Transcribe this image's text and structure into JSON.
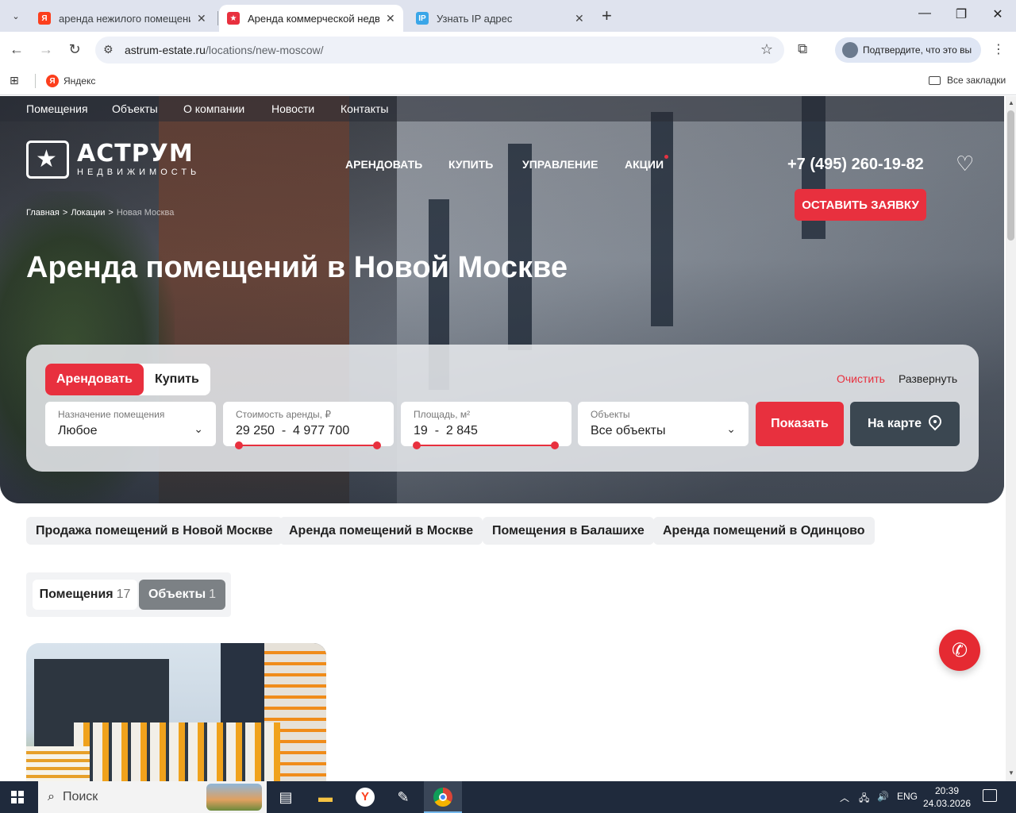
{
  "browser": {
    "tabs": [
      {
        "title": "аренда нежилого помещения",
        "favicon": "yandex-icon",
        "active": false
      },
      {
        "title": "Аренда коммерческой недвиж",
        "favicon": "astrum-icon",
        "active": true
      },
      {
        "title": "Узнать IP адрес",
        "favicon": "ip-icon",
        "active": false
      }
    ],
    "url_host": "astrum-estate.ru",
    "url_path": "/locations/new-moscow/",
    "verify_label": "Подтвердите, что это вы",
    "bookmarks": {
      "yandex": "Яндекс",
      "all": "Все закладки"
    }
  },
  "site": {
    "topnav": [
      "Помещения",
      "Объекты",
      "О компании",
      "Новости",
      "Контакты"
    ],
    "logo": {
      "main": "АСТРУМ",
      "sub": "НЕДВИЖИМОСТЬ"
    },
    "mainnav": [
      "АРЕНДОВАТЬ",
      "КУПИТЬ",
      "УПРАВЛЕНИЕ",
      "АКЦИИ"
    ],
    "phone": "+7 (495) 260-19-82",
    "cta": "ОСТАВИТЬ ЗАЯВКУ",
    "breadcrumbs": {
      "home": "Главная",
      "locations": "Локации",
      "current": "Новая Москва",
      "sep": ">"
    },
    "title": "Аренда помещений в Новой Москве",
    "filter": {
      "rent": "Арендовать",
      "buy": "Купить",
      "clear": "Очистить",
      "expand": "Развернуть",
      "purpose": {
        "label": "Назначение помещения",
        "value": "Любое"
      },
      "price": {
        "label": "Стоимость аренды, ₽",
        "min": "29 250",
        "max": "4 977 700"
      },
      "area": {
        "label": "Площадь, м²",
        "min": "19",
        "max": "2 845"
      },
      "objects": {
        "label": "Объекты",
        "value": "Все объекты"
      },
      "show": "Показать",
      "map": "На карте"
    },
    "quicklinks": [
      "Продажа помещений в Новой Москве",
      "Аренда помещений в Москве",
      "Помещения в Балашихе",
      "Аренда помещений в Одинцово"
    ],
    "result_tabs": [
      {
        "label": "Помещения",
        "count": "17"
      },
      {
        "label": "Объекты",
        "count": "1"
      }
    ],
    "accent_color": "#e8303e"
  },
  "taskbar": {
    "search_placeholder": "Поиск",
    "lang": "ENG",
    "time": "20:39",
    "date": "24.03.2026"
  }
}
